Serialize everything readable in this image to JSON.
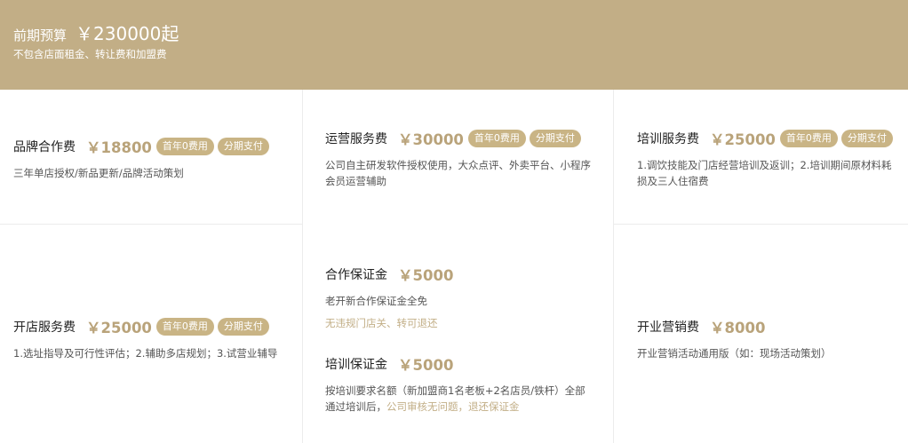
{
  "banner": {
    "label": "前期预算",
    "amount": "￥230000起",
    "note": "不包含店面租金、转让费和加盟费"
  },
  "tags": {
    "first_year_free": "首年0费用",
    "installment": "分期支付"
  },
  "fees": {
    "brand": {
      "name": "品牌合作费",
      "price": "￥18800",
      "desc": "三年单店授权/新品更新/品牌活动策划"
    },
    "operation": {
      "name": "运营服务费",
      "price": "￥30000",
      "desc": "公司自主研发软件授权使用，大众点评、外卖平台、小程序会员运营辅助"
    },
    "training": {
      "name": "培训服务费",
      "price": "￥25000",
      "desc": "1.调饮技能及门店经营培训及返训；2.培训期间原材料耗损及三人住宿费"
    },
    "opening": {
      "name": "开店服务费",
      "price": "￥25000",
      "desc": "1.选址指导及可行性评估；2.辅助多店规划；3.试营业辅导"
    },
    "cooperation_deposit": {
      "name": "合作保证金",
      "price": "￥5000",
      "desc": "老开新合作保证金全免",
      "note": "无违规门店关、转可退还"
    },
    "training_deposit": {
      "name": "培训保证金",
      "price": "￥5000",
      "desc": "按培训要求名额（新加盟商1名老板+2名店员/铁杆）全部通过培训后，",
      "desc_highlight": "公司审核无问题，退还保证金"
    },
    "marketing": {
      "name": "开业营销费",
      "price": "￥8000",
      "desc": "开业营销活动通用版（如：现场活动策划）"
    }
  }
}
